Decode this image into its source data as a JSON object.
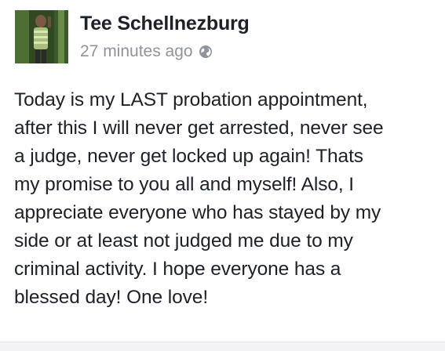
{
  "post": {
    "author": "Tee Schellnezburg",
    "timestamp": "27 minutes ago",
    "privacy_icon": "globe-icon",
    "text": "Today is my LAST probation appointment,\nafter this I will never get arrested, never see\na judge, never get locked up again! Thats\nmy promise to you all and myself! Also, I\nappreciate everyone who has stayed by my\nside or at least not judged me due to my\ncriminal activity. I hope everyone has a\nblessed day! One love!"
  },
  "colors": {
    "name": "#1d2129",
    "meta": "#90949c",
    "body_text": "#1d2129",
    "background": "#ffffff",
    "divider": "#f2f3f5"
  }
}
